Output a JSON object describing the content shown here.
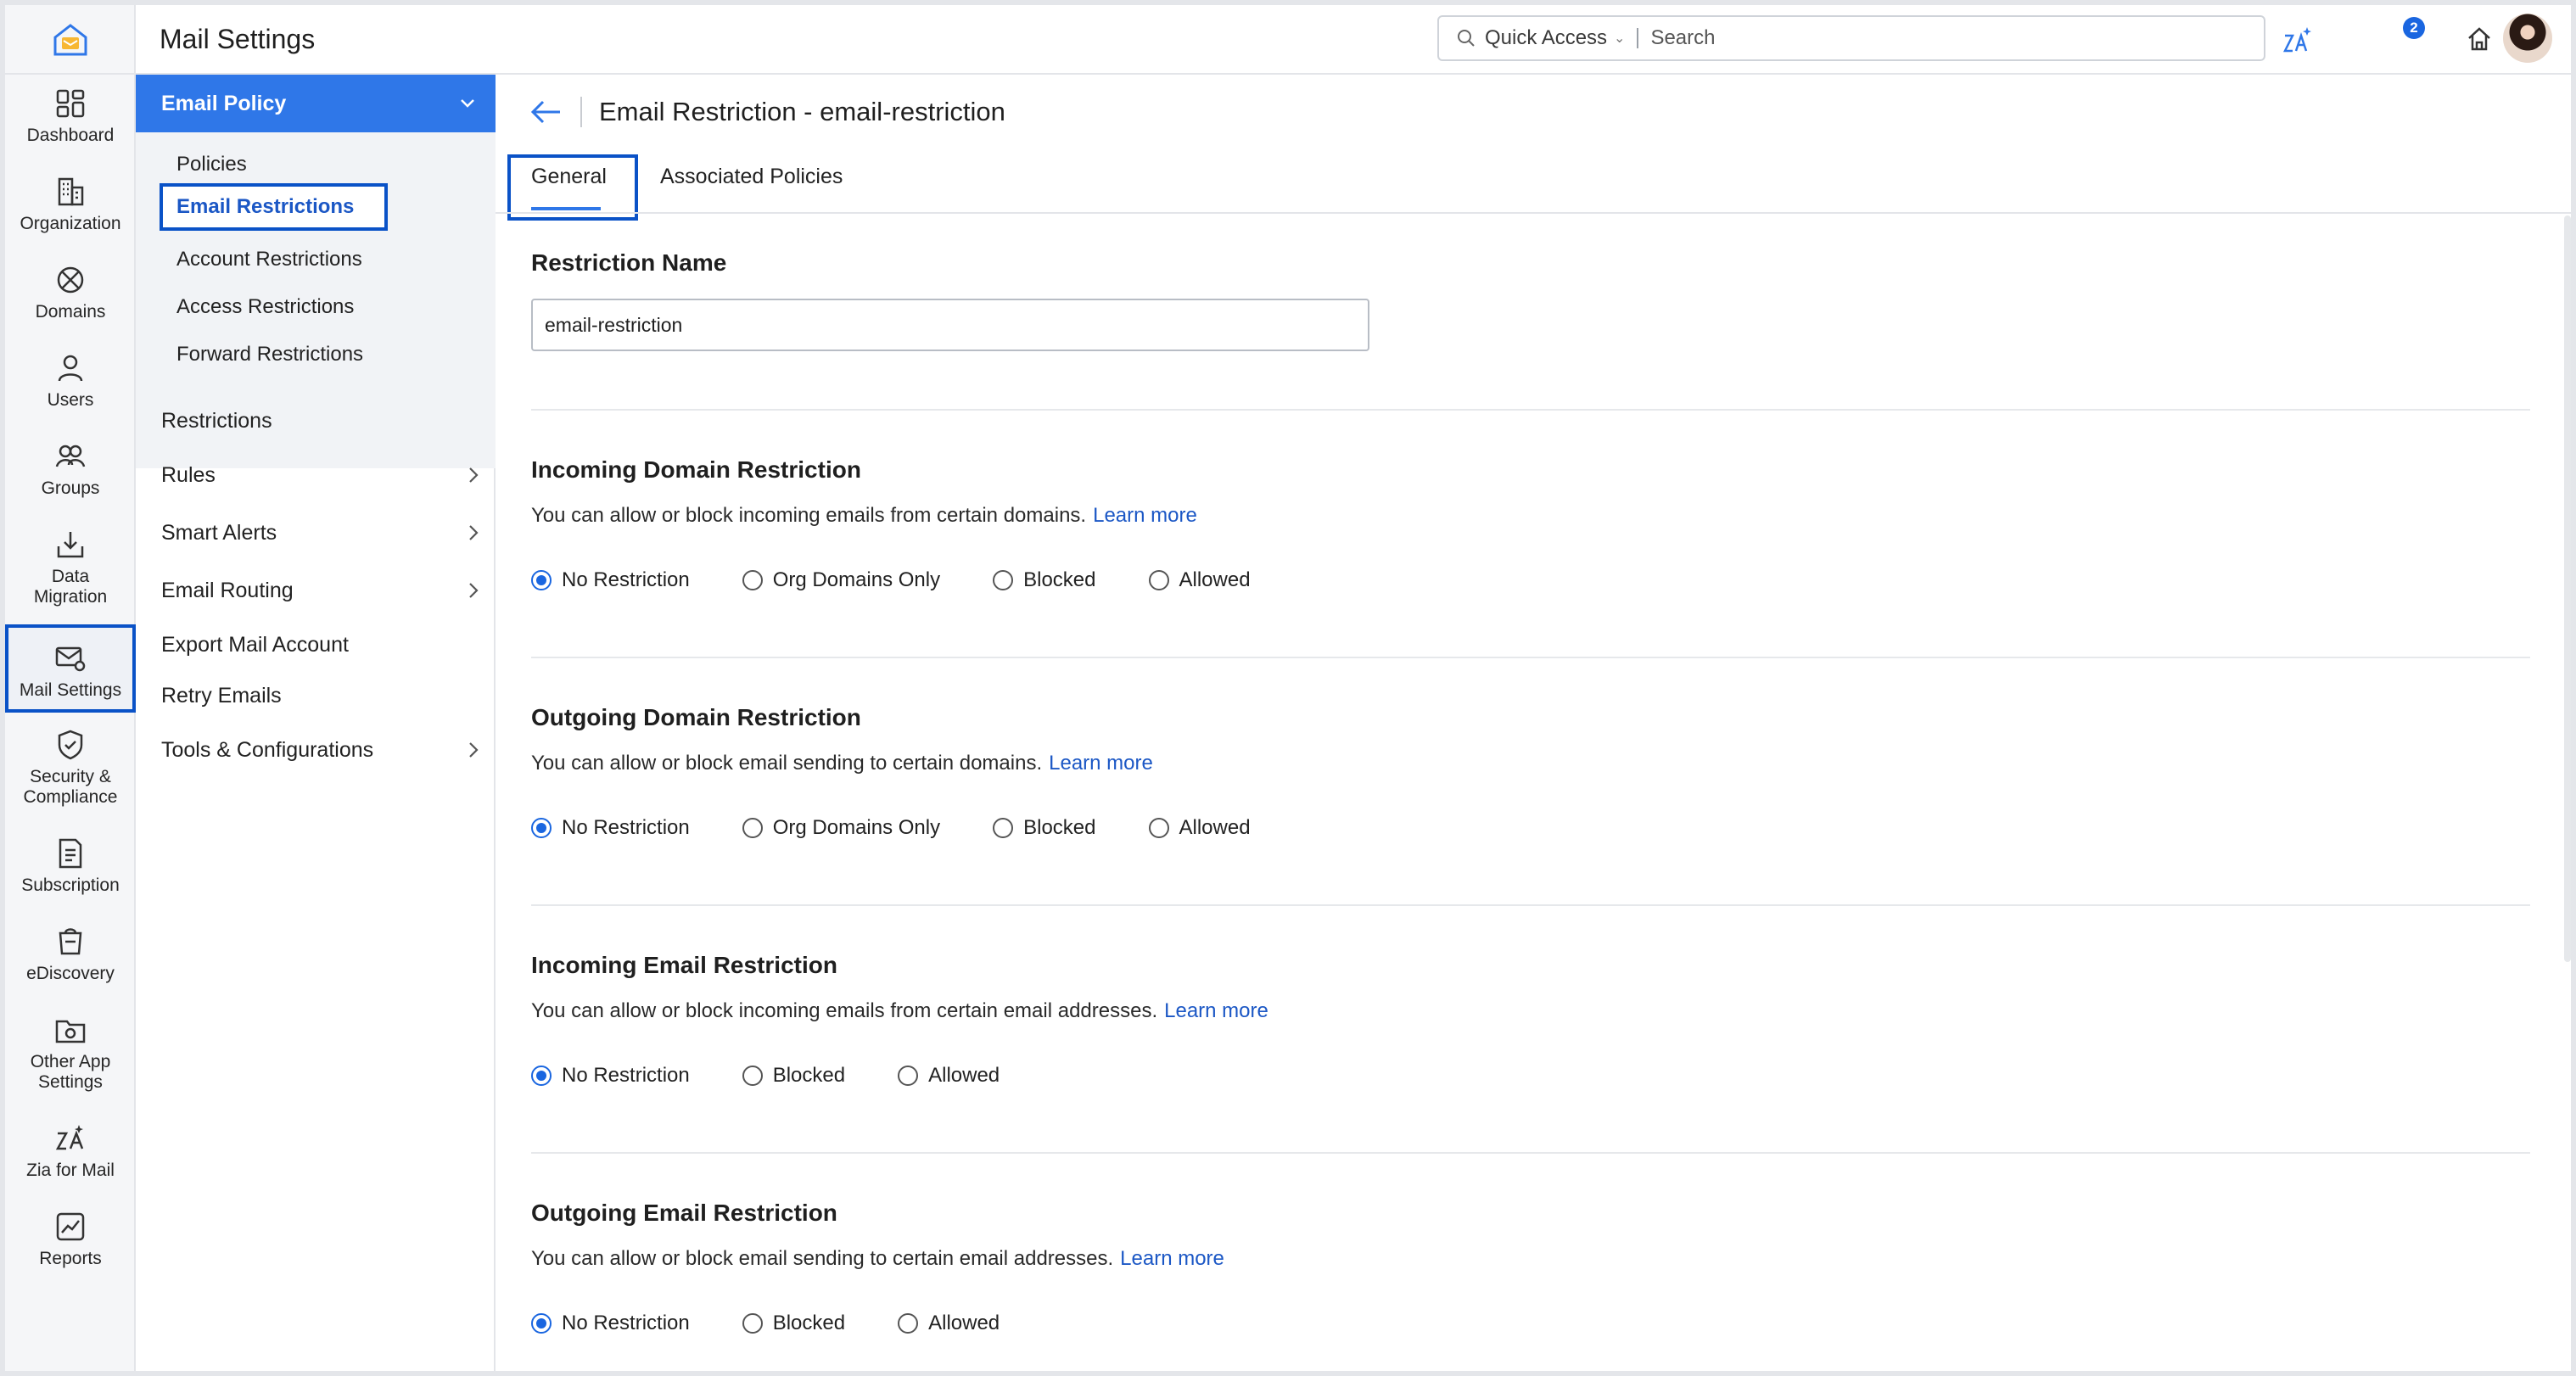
{
  "topbar": {
    "title": "Mail Settings",
    "search_scope": "Quick Access",
    "search_placeholder": "Search",
    "notification_count": "2"
  },
  "rail": [
    {
      "label": "Dashboard",
      "icon": "dashboard-icon"
    },
    {
      "label": "Organization",
      "icon": "organization-icon"
    },
    {
      "label": "Domains",
      "icon": "domains-icon"
    },
    {
      "label": "Users",
      "icon": "users-icon"
    },
    {
      "label": "Groups",
      "icon": "groups-icon"
    },
    {
      "label": "Data\nMigration",
      "icon": "data-migration-icon"
    },
    {
      "label": "Mail Settings",
      "icon": "mail-settings-icon",
      "active": true
    },
    {
      "label": "Security &\nCompliance",
      "icon": "security-icon"
    },
    {
      "label": "Subscription",
      "icon": "subscription-icon"
    },
    {
      "label": "eDiscovery",
      "icon": "ediscovery-icon"
    },
    {
      "label": "Other App\nSettings",
      "icon": "other-app-settings-icon"
    },
    {
      "label": "Zia for Mail",
      "icon": "zia-icon"
    },
    {
      "label": "Reports",
      "icon": "reports-icon"
    }
  ],
  "subnav": {
    "header": "Email Policy",
    "group_items": [
      "Policies",
      "Email Restrictions",
      "Account Restrictions",
      "Access Restrictions",
      "Forward Restrictions"
    ],
    "items": [
      {
        "label": "Restrictions",
        "has_children": false
      },
      {
        "label": "Rules",
        "has_children": true
      },
      {
        "label": "Smart Alerts",
        "has_children": true
      },
      {
        "label": "Email Routing",
        "has_children": true
      },
      {
        "label": "Export Mail Account",
        "has_children": false
      },
      {
        "label": "Retry Emails",
        "has_children": false
      },
      {
        "label": "Tools & Configurations",
        "has_children": true
      }
    ]
  },
  "main": {
    "title": "Email Restriction - email-restriction",
    "tabs": [
      "General",
      "Associated Policies"
    ],
    "restriction_name_label": "Restriction Name",
    "restriction_name_value": "email-restriction",
    "learn_more": "Learn more",
    "sections": [
      {
        "title": "Incoming Domain Restriction",
        "desc": "You can allow or block incoming emails from certain domains.",
        "options": [
          "No Restriction",
          "Org Domains Only",
          "Blocked",
          "Allowed"
        ],
        "selected": 0
      },
      {
        "title": "Outgoing Domain Restriction",
        "desc": "You can allow or block email sending to certain domains.",
        "options": [
          "No Restriction",
          "Org Domains Only",
          "Blocked",
          "Allowed"
        ],
        "selected": 0
      },
      {
        "title": "Incoming Email Restriction",
        "desc": "You can allow or block incoming emails from certain email addresses.",
        "options": [
          "No Restriction",
          "Blocked",
          "Allowed"
        ],
        "selected": 0
      },
      {
        "title": "Outgoing Email Restriction",
        "desc": "You can allow or block email sending to certain email addresses.",
        "options": [
          "No Restriction",
          "Blocked",
          "Allowed"
        ],
        "selected": 0
      }
    ]
  },
  "colors": {
    "accent": "#2f77e8",
    "highlight": "#0a52c7",
    "link": "#1b57c5"
  }
}
